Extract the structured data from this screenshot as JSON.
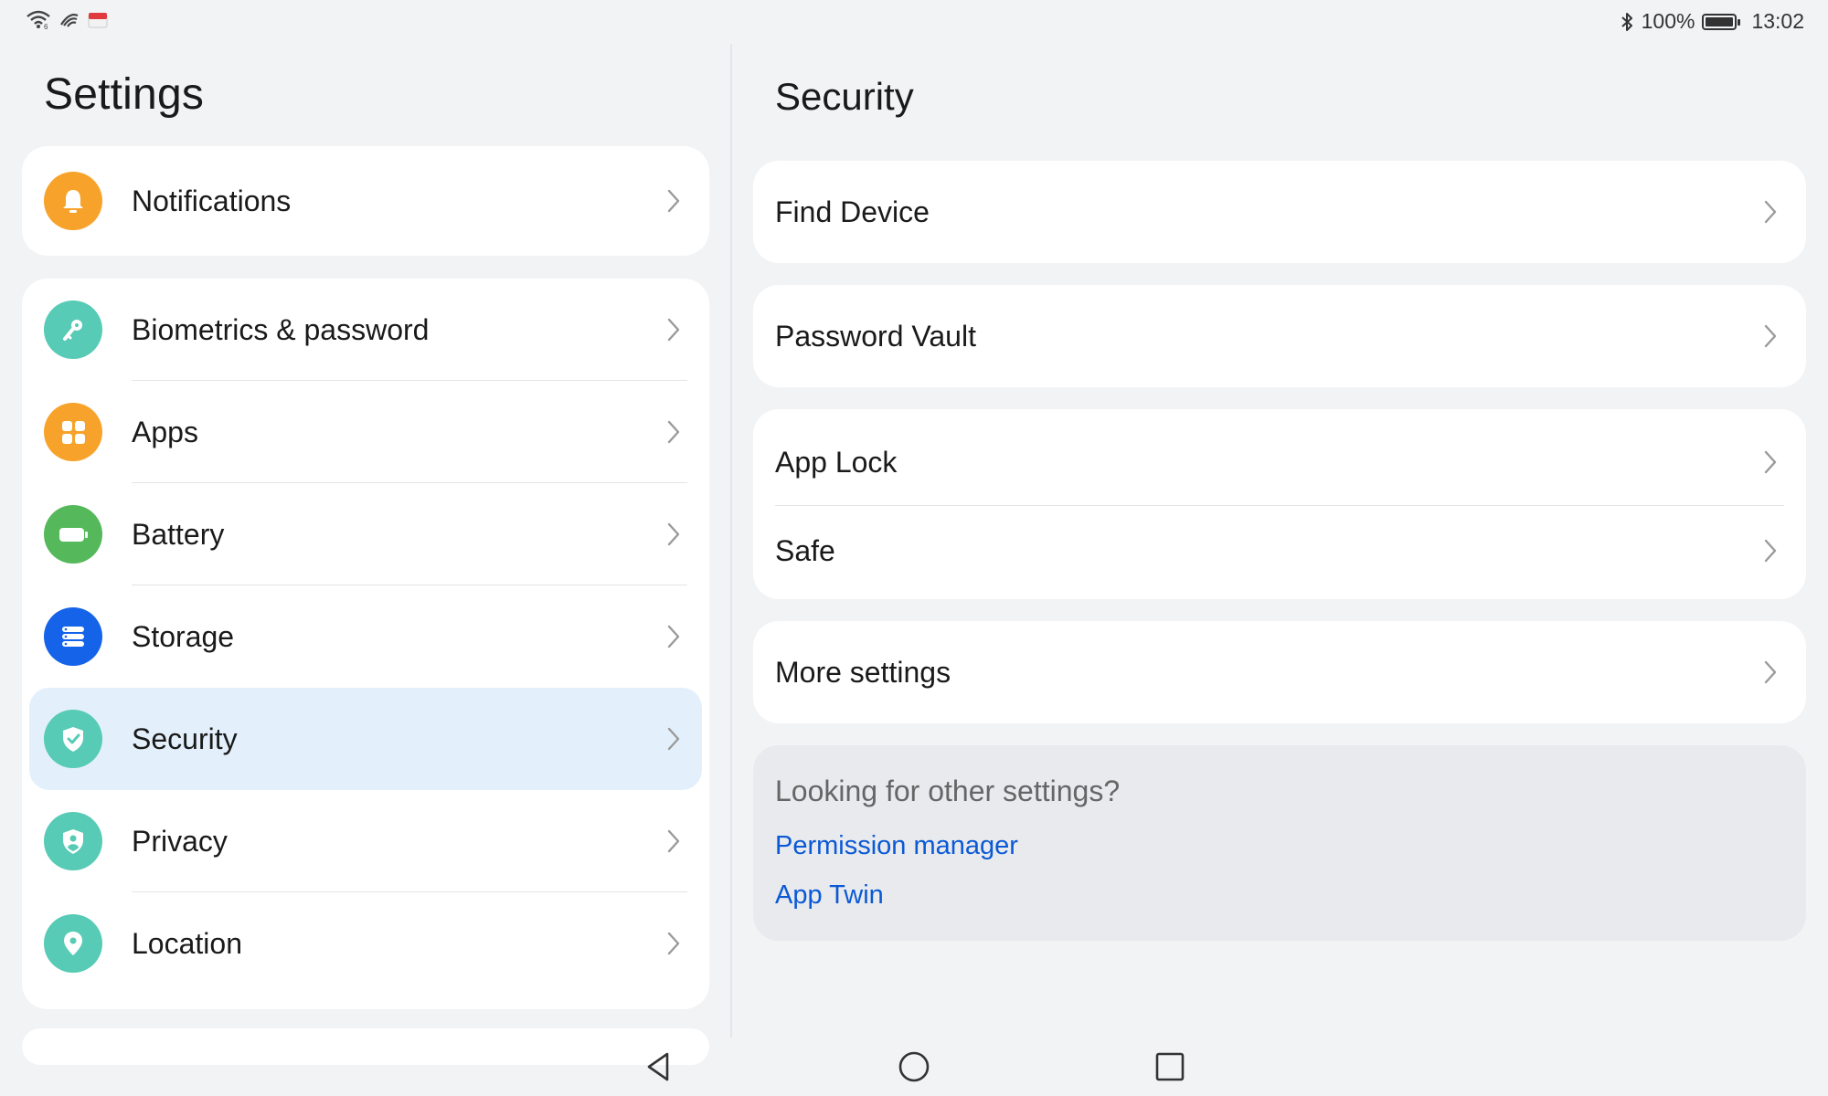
{
  "status_bar": {
    "icons_left": [
      "wifi-icon",
      "nfc-icon",
      "notification-app-icon"
    ],
    "bluetooth_icon": "bluetooth-icon",
    "battery_percent": "100%",
    "battery_level": 1.0,
    "time": "13:02"
  },
  "left": {
    "title": "Settings",
    "notifications": {
      "label": "Notifications",
      "icon": "bell-icon",
      "color": "#f7a32b"
    },
    "items": [
      {
        "label": "Biometrics & password",
        "icon": "key-icon",
        "color": "#57cbb5"
      },
      {
        "label": "Apps",
        "icon": "apps-grid-icon",
        "color": "#f7a32b"
      },
      {
        "label": "Battery",
        "icon": "battery-icon",
        "color": "#55b85a"
      },
      {
        "label": "Storage",
        "icon": "storage-icon",
        "color": "#1463e8"
      },
      {
        "label": "Security",
        "icon": "shield-check-icon",
        "color": "#57cbb5",
        "selected": true
      },
      {
        "label": "Privacy",
        "icon": "privacy-shield-icon",
        "color": "#57cbb5"
      },
      {
        "label": "Location",
        "icon": "location-pin-icon",
        "color": "#57cbb5"
      }
    ]
  },
  "right": {
    "title": "Security",
    "groups": [
      {
        "items": [
          "Find Device"
        ]
      },
      {
        "items": [
          "Password Vault"
        ]
      },
      {
        "items": [
          "App Lock",
          "Safe"
        ]
      },
      {
        "items": [
          "More settings"
        ]
      }
    ],
    "suggestions": {
      "question": "Looking for other settings?",
      "links": [
        "Permission manager",
        "App Twin"
      ]
    }
  },
  "navbar": {
    "back": "back-triangle-icon",
    "home": "home-circle-icon",
    "recents": "recents-square-icon"
  },
  "colors": {
    "accent_link": "#0a59d6",
    "selected_bg": "#e3f0fc",
    "background": "#f1f3f5"
  }
}
